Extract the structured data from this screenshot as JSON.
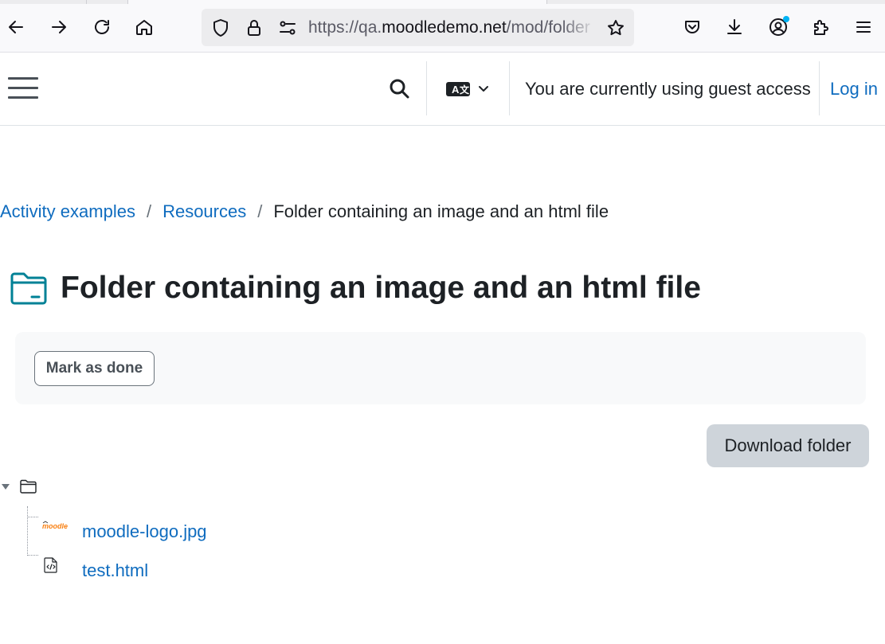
{
  "browser": {
    "url_prefix": "https://qa.",
    "url_host": "moodledemo.net",
    "url_path": "/mod/folder"
  },
  "icons": {
    "back": "back-arrow-icon",
    "forward": "forward-arrow-icon",
    "reload": "reload-icon",
    "home": "home-icon",
    "shield": "shield-icon",
    "lock": "lock-icon",
    "permissions": "permissions-icon",
    "bookmark": "star-icon",
    "pocket": "pocket-icon",
    "downloads": "download-icon",
    "account": "account-icon",
    "extensions": "puzzle-icon",
    "menu": "menu-icon",
    "language": "language-icon",
    "search": "search-icon",
    "folder": "folder-icon",
    "html_file": "html-file-icon",
    "image_thumb": "moodle-logo-thumbnail"
  },
  "navbar": {
    "guest_notice": "You are currently using guest access",
    "login_label": "Log in"
  },
  "breadcrumb": {
    "items": [
      "Activity examples",
      "Resources"
    ],
    "separator": "/",
    "current": "Folder containing an image and an html file"
  },
  "page": {
    "title": "Folder containing an image and an html file",
    "mark_done_label": "Mark as done",
    "download_label": "Download folder"
  },
  "files": [
    {
      "name": "moodle-logo.jpg",
      "type": "image"
    },
    {
      "name": "test.html",
      "type": "html"
    }
  ],
  "colors": {
    "link": "#0f6cbf",
    "text": "#1d2125",
    "folder_icon": "#008196",
    "download_button_bg": "#ced4da",
    "activity_panel_bg": "#f8f9fa"
  }
}
